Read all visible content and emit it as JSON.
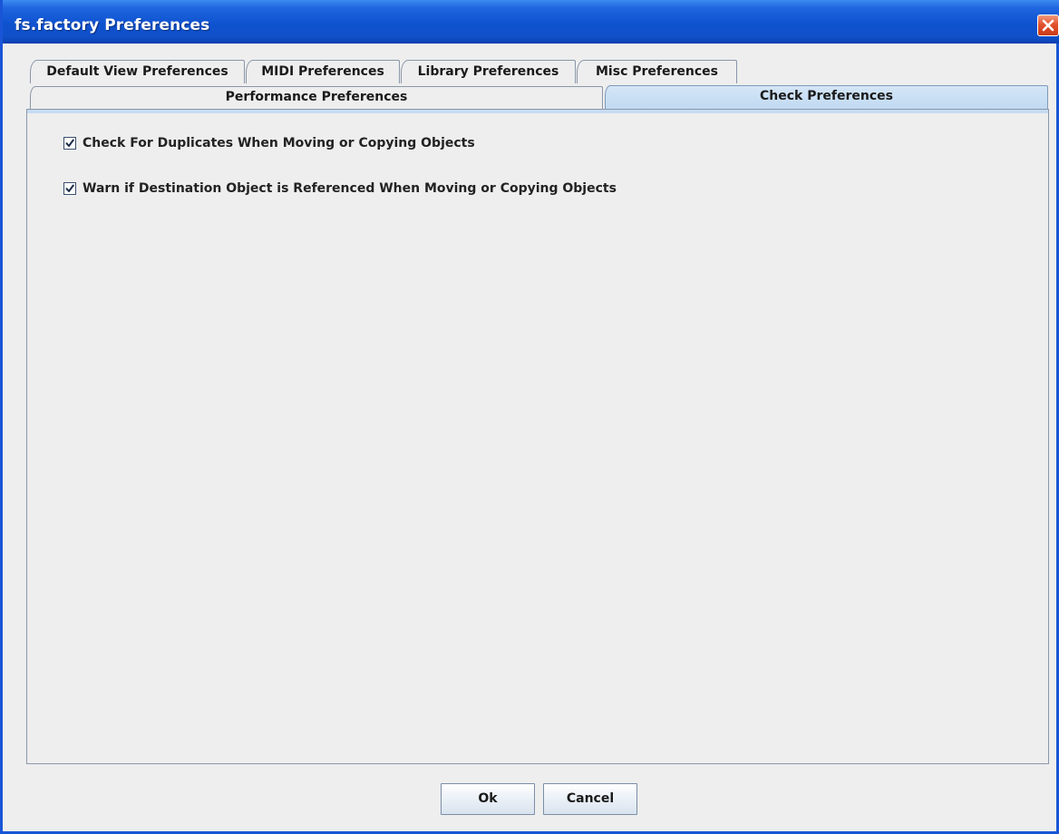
{
  "window": {
    "title": "fs.factory Preferences"
  },
  "tabs": {
    "row1": [
      {
        "label": "Default View Preferences"
      },
      {
        "label": "MIDI Preferences"
      },
      {
        "label": "Library Preferences"
      },
      {
        "label": "Misc Preferences"
      }
    ],
    "row2": [
      {
        "label": "Performance Preferences"
      },
      {
        "label": "Check Preferences",
        "selected": true
      }
    ]
  },
  "checks": {
    "duplicates": {
      "label": "Check For Duplicates When Moving or Copying Objects",
      "checked": true
    },
    "referenced": {
      "label": "Warn if Destination Object is Referenced When Moving or Copying Objects",
      "checked": true
    }
  },
  "buttons": {
    "ok_label": "Ok",
    "cancel_label": "Cancel"
  },
  "colors": {
    "titlebar": "#0f52cf",
    "selected_tab": "#c0d9f1"
  },
  "icons": {
    "close": "close-icon",
    "check": "checkmark-icon"
  }
}
